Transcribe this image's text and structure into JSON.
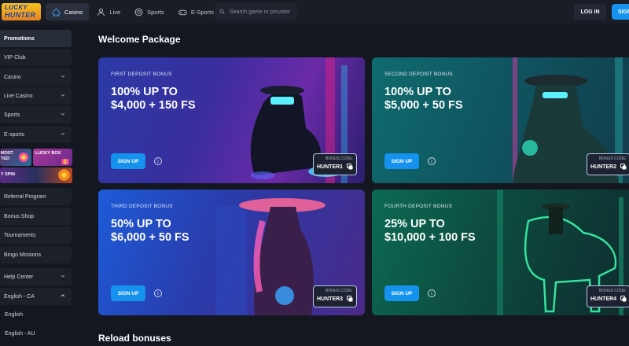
{
  "brand": {
    "line1": "LUCKY",
    "line2": "HUNTER"
  },
  "nav": [
    {
      "label": "Casino",
      "icon": "spade-icon"
    },
    {
      "label": "Live",
      "icon": "person-icon"
    },
    {
      "label": "Sports",
      "icon": "ball-icon"
    },
    {
      "label": "E-Sports",
      "icon": "gamepad-icon"
    }
  ],
  "search": {
    "placeholder": "Search game or provider"
  },
  "auth": {
    "login": "LOG IN",
    "signup": "SIGN"
  },
  "sidebar": {
    "items": [
      {
        "label": "Promotions"
      },
      {
        "label": "VIP Club"
      },
      {
        "label": "Casino"
      },
      {
        "label": "Live Casino"
      },
      {
        "label": "Sports"
      },
      {
        "label": "E-sports"
      }
    ],
    "promos": {
      "a": "MOST\nTED",
      "b": "LUCKY BOX",
      "c": "Y SPIN"
    },
    "links": [
      {
        "label": "Referral Program"
      },
      {
        "label": "Bonus Shop"
      },
      {
        "label": "Tournaments"
      },
      {
        "label": "Bingo Missions"
      },
      {
        "label": "Help Center"
      }
    ],
    "language": {
      "current": "English - CA",
      "options": [
        "English",
        "English - AU"
      ]
    }
  },
  "main": {
    "title": "Welcome Package",
    "reload_title": "Reload bonuses",
    "cards": [
      {
        "label": "FIRST DEPOSIT BONUS",
        "headline": "100% UP TO\n$4,000 + 150 FS",
        "cta": "SIGN UP",
        "code_label": "BONUS CODE:",
        "code": "HUNTER1"
      },
      {
        "label": "SECOND DEPOSIT BONUS",
        "headline": "100% UP TO\n$5,000 + 50 FS",
        "cta": "SIGN UP",
        "code_label": "BONUS CODE:",
        "code": "HUNTER2"
      },
      {
        "label": "THIRD DEPOSIT BONUS",
        "headline": "50% UP TO\n$6,000 + 50 FS",
        "cta": "SIGN UP",
        "code_label": "BONUS CODE:",
        "code": "HUNTER3"
      },
      {
        "label": "FOURTH DEPOSIT BONUS",
        "headline": "25% UP TO\n$10,000 + 100 FS",
        "cta": "SIGN UP",
        "code_label": "BONUS CODE:",
        "code": "HUNTER4"
      }
    ],
    "info_glyph": "i"
  },
  "colors": {
    "accent": "#1592ee",
    "background": "#14171f",
    "panel": "#1c2029"
  }
}
